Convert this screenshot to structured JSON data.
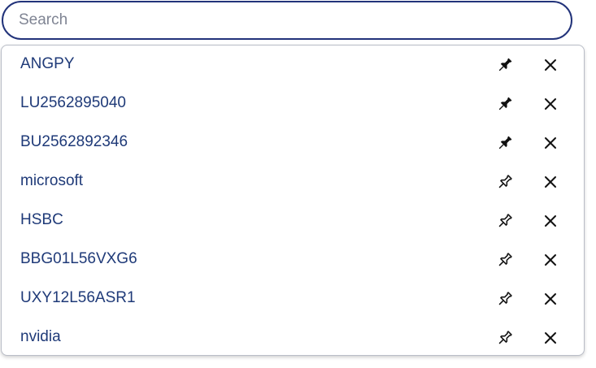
{
  "search": {
    "placeholder": "Search",
    "value": ""
  },
  "results": [
    {
      "label": "ANGPY",
      "pinned": true,
      "pin_icon": "pin-filled-icon",
      "remove_icon": "close-icon"
    },
    {
      "label": "LU2562895040",
      "pinned": true,
      "pin_icon": "pin-filled-icon",
      "remove_icon": "close-icon"
    },
    {
      "label": "BU2562892346",
      "pinned": true,
      "pin_icon": "pin-filled-icon",
      "remove_icon": "close-icon"
    },
    {
      "label": "microsoft",
      "pinned": false,
      "pin_icon": "pin-outline-icon",
      "remove_icon": "close-icon"
    },
    {
      "label": "HSBC",
      "pinned": false,
      "pin_icon": "pin-outline-icon",
      "remove_icon": "close-icon"
    },
    {
      "label": "BBG01L56VXG6",
      "pinned": false,
      "pin_icon": "pin-outline-icon",
      "remove_icon": "close-icon"
    },
    {
      "label": "UXY12L56ASR1",
      "pinned": false,
      "pin_icon": "pin-outline-icon",
      "remove_icon": "close-icon"
    },
    {
      "label": "nvidia",
      "pinned": false,
      "pin_icon": "pin-outline-icon",
      "remove_icon": "close-icon"
    }
  ],
  "colors": {
    "search_border": "#22337a",
    "item_text": "#1f3a78",
    "placeholder": "#7f8493",
    "dropdown_border": "#b9bdc7",
    "icon": "#111111"
  }
}
